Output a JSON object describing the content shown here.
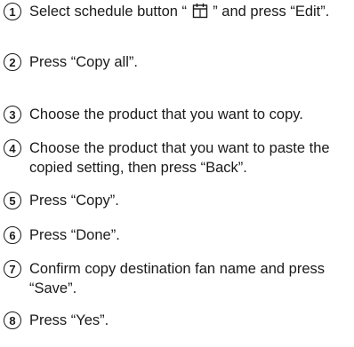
{
  "steps": [
    {
      "number": "1",
      "text_before_icon": "Select schedule button “ ",
      "icon": "calendar-icon",
      "text_after_icon": " ” and press “Edit”."
    },
    {
      "number": "2",
      "text": "Press “Copy all”."
    },
    {
      "number": "3",
      "text": "Choose the product that you want to copy."
    },
    {
      "number": "4",
      "text": "Choose the product that you want to paste the copied setting, then press “Back”."
    },
    {
      "number": "5",
      "text": "Press “Copy”."
    },
    {
      "number": "6",
      "text": "Press “Done”."
    },
    {
      "number": "7",
      "text": "Confirm copy destination fan name and press “Save”."
    },
    {
      "number": "8",
      "text": "Press “Yes”."
    }
  ]
}
